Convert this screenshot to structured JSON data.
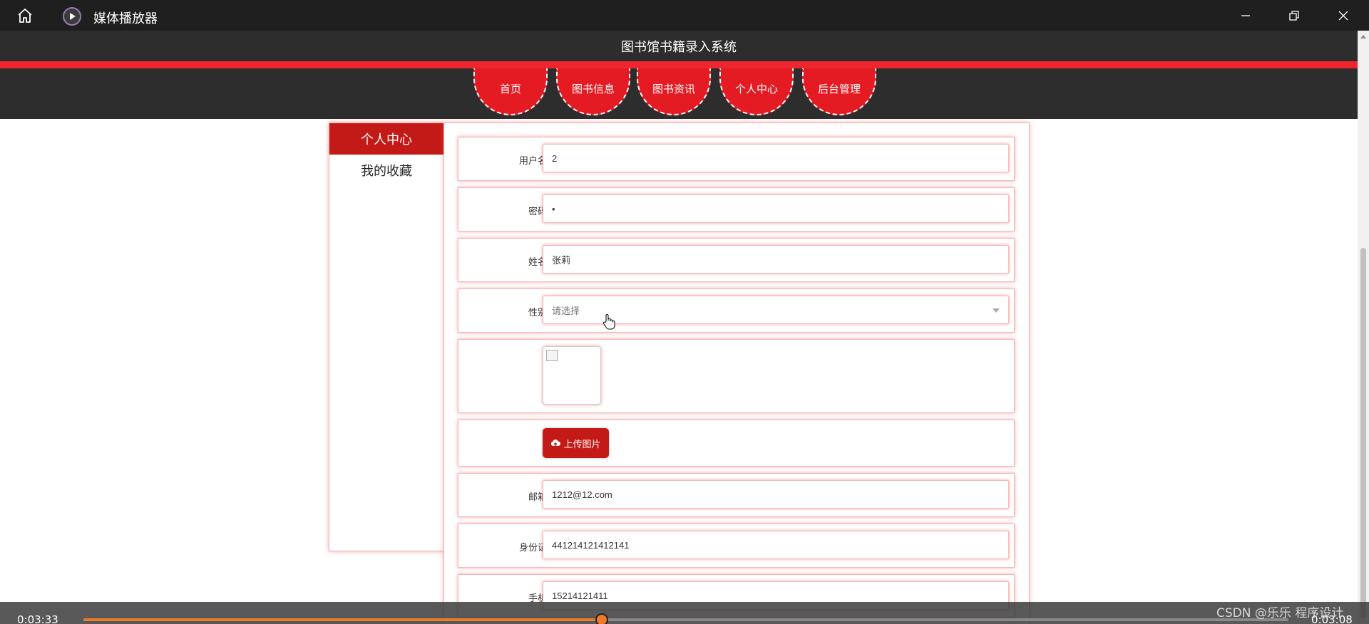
{
  "player": {
    "title": "媒体播放器",
    "current_time": "0:03:33",
    "total_time": "0:03:08",
    "progress_fraction": 0.43,
    "watermark": "CSDN @乐乐 程序设计",
    "accent_color": "#f07a2a"
  },
  "site": {
    "title": "图书馆书籍录入系统",
    "brand_color": "#e51b23",
    "nav": [
      {
        "label": "首页"
      },
      {
        "label": "图书信息"
      },
      {
        "label": "图书资讯"
      },
      {
        "label": "个人中心"
      },
      {
        "label": "后台管理"
      }
    ]
  },
  "sidebar": {
    "items": [
      {
        "label": "个人中心",
        "active": true
      },
      {
        "label": "我的收藏",
        "active": false
      }
    ]
  },
  "form": {
    "username": {
      "label": "用户名",
      "value": "2"
    },
    "password": {
      "label": "密码",
      "value": "•"
    },
    "name": {
      "label": "姓名",
      "value": "张莉"
    },
    "gender": {
      "label": "性别",
      "placeholder": "请选择"
    },
    "upload_label": "上传图片",
    "email": {
      "label": "邮箱",
      "value": "1212@12.com"
    },
    "id_card": {
      "label": "身份证",
      "value": "441214121412141"
    },
    "phone": {
      "label": "手机",
      "value": "15214121411"
    }
  },
  "icons": {
    "home": "home-icon",
    "play": "play-icon",
    "minimize": "minimize-icon",
    "restore": "restore-icon",
    "close": "close-icon",
    "upload": "cloud-upload-icon",
    "dropdown": "chevron-down-icon"
  }
}
